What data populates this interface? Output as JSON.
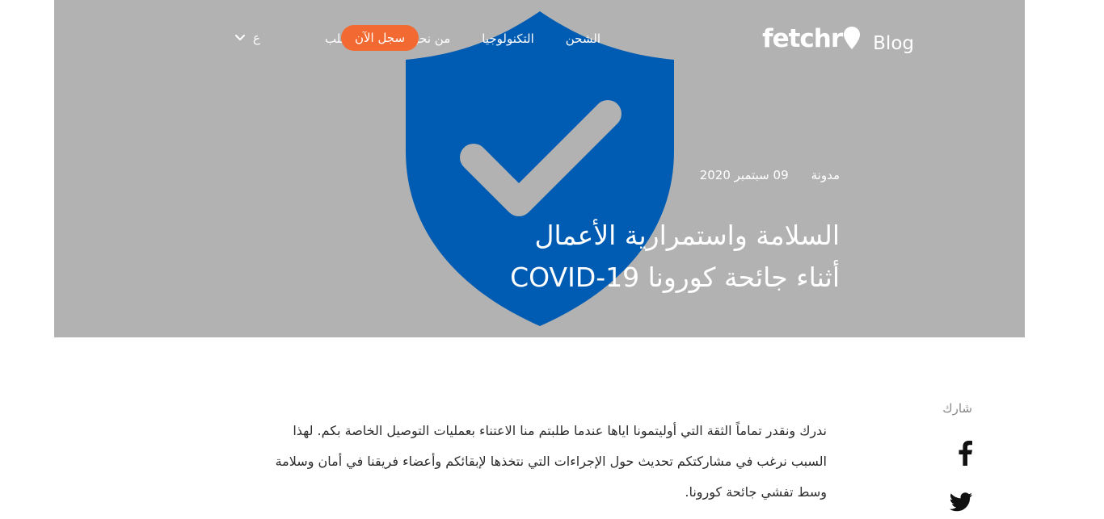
{
  "header": {
    "logo_text": "fetchr",
    "logo_suffix": "Blog",
    "nav": [
      {
        "label": "الشحن"
      },
      {
        "label": "التكنولوجيا"
      },
      {
        "label": "من نحن"
      },
      {
        "label": "تتبع الطلب"
      }
    ],
    "signup_label": "سجل الآن",
    "language_label": "ع"
  },
  "hero": {
    "category": "مدونة",
    "date": "09 سبتمبر 2020",
    "title_line1": "السلامة واستمرارية الأعمال",
    "title_line2": "أثناء جائحة كورونا  COVID-19",
    "shield_icon": "shield-check-icon"
  },
  "share": {
    "label": "شارك",
    "icons": [
      "facebook-icon",
      "twitter-icon"
    ]
  },
  "article": {
    "paragraph": "ندرك ونقدر تماماً الثقة التي أوليتمونا اياها عندما طلبتم منا الاعتناء بعمليات التوصيل الخاصة بكم. لهذا السبب نرغب في مشاركتكم تحديث حول الإجراءات التي نتخذها لإبقائكم وأعضاء فريقنا في أمان وسلامة وسط تفشي جائحة كورونا."
  },
  "colors": {
    "hero_bg": "#b2b2b2",
    "shield_blue": "#005cb3",
    "accent_orange": "#f26a32",
    "text_dark": "#2b2b2b",
    "share_grey": "#8a8a8a"
  }
}
